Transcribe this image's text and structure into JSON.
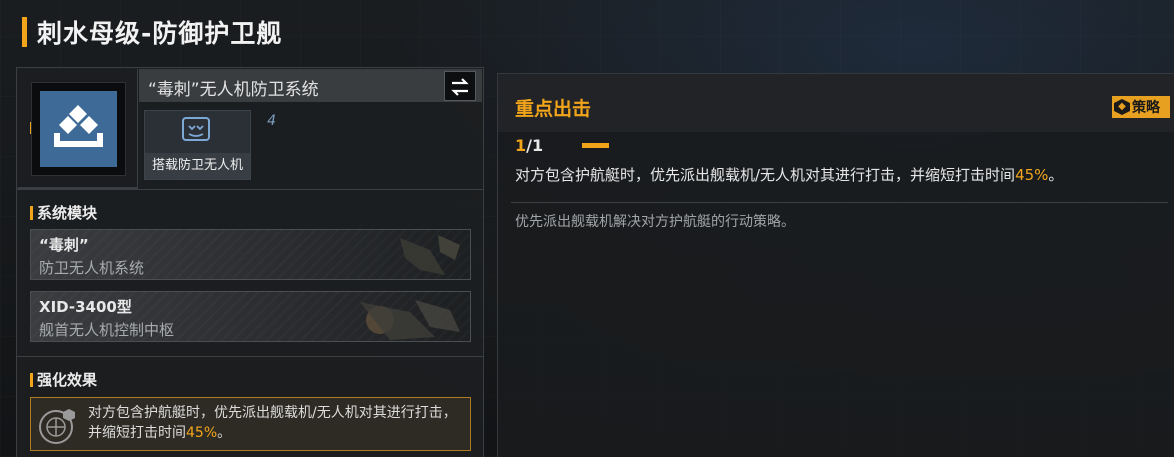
{
  "page_title": "刺水母级-防御护卫舰",
  "system": {
    "name": "“毒刺”无人机防卫系统",
    "swap_icon": "swap-arrows-icon",
    "drone_card": {
      "count": "4",
      "label": "搭载防卫无人机"
    }
  },
  "modules_section": {
    "title": "系统模块",
    "items": [
      {
        "name": "“毒刺”",
        "desc": "防卫无人机系统"
      },
      {
        "name": "XID-3400型",
        "desc": "舰首无人机控制中枢"
      }
    ]
  },
  "enhance_section": {
    "title": "强化效果",
    "text_before": "对方包含护航艇时，优先派出舰载机/无人机对其进行打击，并缩短打击时间",
    "highlight": "45%",
    "text_after": "。"
  },
  "strategy": {
    "title": "重点出击",
    "button_label": "策略",
    "page_current": "1",
    "page_total": "/1",
    "desc_before": "对方包含护航艇时，优先派出舰载机/无人机对其进行打击，并缩短打击时间",
    "desc_highlight": "45%",
    "desc_after": "。",
    "note": "优先派出舰载机解决对方护航艇的行动策略。"
  },
  "colors": {
    "accent": "#f2a51a",
    "icon_bg": "#3d6a97"
  }
}
